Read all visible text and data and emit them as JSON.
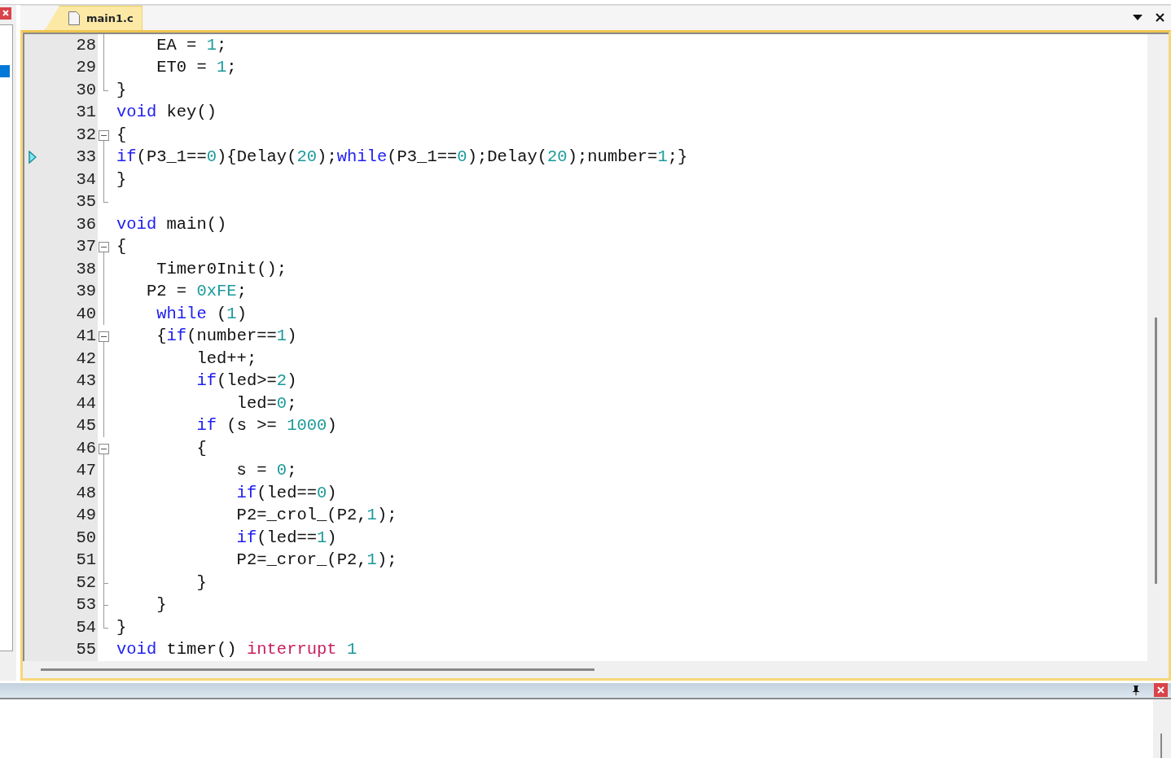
{
  "editor": {
    "tabs": [
      {
        "label": "main1.c",
        "selected": true
      }
    ],
    "lines": [
      {
        "number": "28",
        "kind": "line",
        "current": false,
        "tokens": [
          {
            "kind": "plain",
            "text": "    EA = "
          },
          {
            "kind": "number",
            "text": "1"
          },
          {
            "kind": "plain",
            "text": ";"
          }
        ]
      },
      {
        "number": "29",
        "kind": "line",
        "current": false,
        "tokens": [
          {
            "kind": "plain",
            "text": "    ET0 = "
          },
          {
            "kind": "number",
            "text": "1"
          },
          {
            "kind": "plain",
            "text": ";"
          }
        ]
      },
      {
        "number": "30",
        "kind": "end",
        "current": false,
        "tokens": [
          {
            "kind": "plain",
            "text": "}"
          }
        ]
      },
      {
        "number": "31",
        "kind": "none",
        "current": false,
        "tokens": [
          {
            "kind": "keyword",
            "text": "void"
          },
          {
            "kind": "plain",
            "text": " key()"
          }
        ]
      },
      {
        "number": "32",
        "kind": "box",
        "current": false,
        "tokens": [
          {
            "kind": "plain",
            "text": "{"
          }
        ]
      },
      {
        "number": "33",
        "kind": "line",
        "current": true,
        "tokens": [
          {
            "kind": "keyword",
            "text": "if"
          },
          {
            "kind": "plain",
            "text": "(P3_1=="
          },
          {
            "kind": "number",
            "text": "0"
          },
          {
            "kind": "plain",
            "text": "){Delay("
          },
          {
            "kind": "number",
            "text": "20"
          },
          {
            "kind": "plain",
            "text": ");"
          },
          {
            "kind": "keyword",
            "text": "while"
          },
          {
            "kind": "plain",
            "text": "(P3_1=="
          },
          {
            "kind": "number",
            "text": "0"
          },
          {
            "kind": "plain",
            "text": ");Delay("
          },
          {
            "kind": "number",
            "text": "20"
          },
          {
            "kind": "plain",
            "text": ");number="
          },
          {
            "kind": "number",
            "text": "1"
          },
          {
            "kind": "plain",
            "text": ";}"
          }
        ]
      },
      {
        "number": "34",
        "kind": "line",
        "current": false,
        "tokens": [
          {
            "kind": "plain",
            "text": "}"
          }
        ]
      },
      {
        "number": "35",
        "kind": "end",
        "current": false
      },
      {
        "number": "36",
        "kind": "none",
        "current": false,
        "tokens": [
          {
            "kind": "keyword",
            "text": "void"
          },
          {
            "kind": "plain",
            "text": " main()"
          }
        ]
      },
      {
        "number": "37",
        "kind": "box",
        "current": false,
        "tokens": [
          {
            "kind": "plain",
            "text": "{"
          }
        ]
      },
      {
        "number": "38",
        "kind": "line",
        "current": false,
        "tokens": [
          {
            "kind": "plain",
            "text": "    Timer0Init();"
          }
        ]
      },
      {
        "number": "39",
        "kind": "line",
        "current": false,
        "tokens": [
          {
            "kind": "plain",
            "text": "   P2 = "
          },
          {
            "kind": "number",
            "text": "0xFE"
          },
          {
            "kind": "plain",
            "text": ";"
          }
        ]
      },
      {
        "number": "40",
        "kind": "line",
        "current": false,
        "tokens": [
          {
            "kind": "keyword",
            "text": "    while"
          },
          {
            "kind": "plain",
            "text": " ("
          },
          {
            "kind": "number",
            "text": "1"
          },
          {
            "kind": "plain",
            "text": ")"
          }
        ]
      },
      {
        "number": "41",
        "kind": "box",
        "current": false,
        "tokens": [
          {
            "kind": "plain",
            "text": "    {"
          },
          {
            "kind": "keyword",
            "text": "if"
          },
          {
            "kind": "plain",
            "text": "(number=="
          },
          {
            "kind": "number",
            "text": "1"
          },
          {
            "kind": "plain",
            "text": ")"
          }
        ]
      },
      {
        "number": "42",
        "kind": "line",
        "current": false,
        "tokens": [
          {
            "kind": "plain",
            "text": "        led++;"
          }
        ]
      },
      {
        "number": "43",
        "kind": "line",
        "current": false,
        "tokens": [
          {
            "kind": "keyword",
            "text": "        if"
          },
          {
            "kind": "plain",
            "text": "(led>="
          },
          {
            "kind": "number",
            "text": "2"
          },
          {
            "kind": "plain",
            "text": ")"
          }
        ]
      },
      {
        "number": "44",
        "kind": "line",
        "current": false,
        "tokens": [
          {
            "kind": "plain",
            "text": "            led="
          },
          {
            "kind": "number",
            "text": "0"
          },
          {
            "kind": "plain",
            "text": ";"
          }
        ]
      },
      {
        "number": "45",
        "kind": "line",
        "current": false,
        "tokens": [
          {
            "kind": "keyword",
            "text": "        if"
          },
          {
            "kind": "plain",
            "text": " (s >= "
          },
          {
            "kind": "number",
            "text": "1000"
          },
          {
            "kind": "plain",
            "text": ")"
          }
        ]
      },
      {
        "number": "46",
        "kind": "box",
        "current": false,
        "tokens": [
          {
            "kind": "plain",
            "text": "        {"
          }
        ]
      },
      {
        "number": "47",
        "kind": "line",
        "current": false,
        "tokens": [
          {
            "kind": "plain",
            "text": "            s = "
          },
          {
            "kind": "number",
            "text": "0"
          },
          {
            "kind": "plain",
            "text": ";"
          }
        ]
      },
      {
        "number": "48",
        "kind": "line",
        "current": false,
        "tokens": [
          {
            "kind": "keyword",
            "text": "            if"
          },
          {
            "kind": "plain",
            "text": "(led=="
          },
          {
            "kind": "number",
            "text": "0"
          },
          {
            "kind": "plain",
            "text": ")"
          }
        ]
      },
      {
        "number": "49",
        "kind": "line",
        "current": false,
        "tokens": [
          {
            "kind": "plain",
            "text": "            P2=_crol_(P2,"
          },
          {
            "kind": "number",
            "text": "1"
          },
          {
            "kind": "plain",
            "text": ");"
          }
        ]
      },
      {
        "number": "50",
        "kind": "line",
        "current": false,
        "tokens": [
          {
            "kind": "keyword",
            "text": "            if"
          },
          {
            "kind": "plain",
            "text": "(led=="
          },
          {
            "kind": "number",
            "text": "1"
          },
          {
            "kind": "plain",
            "text": ")"
          }
        ]
      },
      {
        "number": "51",
        "kind": "line",
        "current": false,
        "tokens": [
          {
            "kind": "plain",
            "text": "            P2=_cror_(P2,"
          },
          {
            "kind": "number",
            "text": "1"
          },
          {
            "kind": "plain",
            "text": ");"
          }
        ]
      },
      {
        "number": "52",
        "kind": "tick",
        "current": false,
        "tokens": [
          {
            "kind": "plain",
            "text": "        }"
          }
        ]
      },
      {
        "number": "53",
        "kind": "tick",
        "current": false,
        "tokens": [
          {
            "kind": "plain",
            "text": "    }"
          }
        ]
      },
      {
        "number": "54",
        "kind": "end",
        "current": false,
        "tokens": [
          {
            "kind": "plain",
            "text": "}"
          }
        ]
      },
      {
        "number": "55",
        "kind": "none",
        "current": false,
        "tokens": [
          {
            "kind": "keyword",
            "text": "void"
          },
          {
            "kind": "plain",
            "text": " timer() "
          },
          {
            "kind": "directive",
            "text": "interrupt"
          },
          {
            "kind": "number",
            "text": " 1"
          }
        ]
      }
    ]
  }
}
